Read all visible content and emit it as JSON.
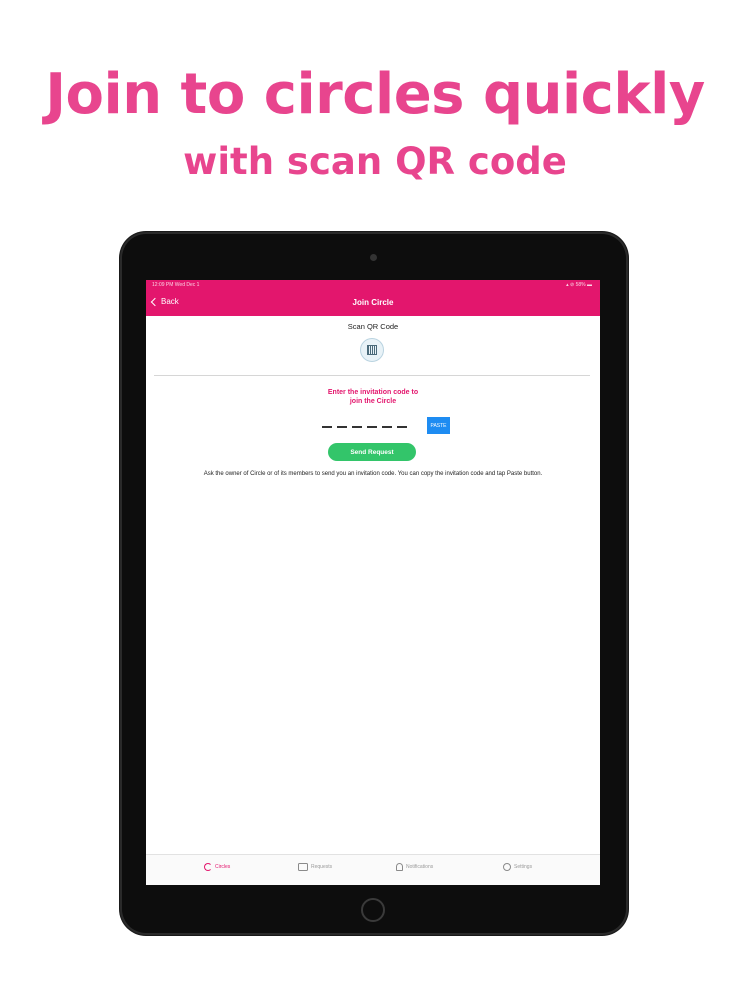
{
  "headline": {
    "line1": "Join to circles quickly",
    "line2": "with scan QR code"
  },
  "status_bar": {
    "time": "12:09 PM   Wed Dec 1",
    "right": "▴ ⊘ 58% ▬"
  },
  "nav": {
    "back_label": "Back",
    "title": "Join Circle"
  },
  "scan": {
    "label": "Scan QR Code",
    "icon": "qr-code-icon"
  },
  "invite": {
    "prompt_line1": "Enter the invitation code to",
    "prompt_line2": "join the Circle",
    "paste_label": "PASTE",
    "send_label": "Send Request",
    "help_text": "Ask the owner of Circle or of its members to send you an invitation code. You can copy the invitation code and tap Paste button."
  },
  "tabs": [
    {
      "label": "Circles",
      "icon": "circles-icon",
      "active": true
    },
    {
      "label": "Requests",
      "icon": "requests-icon",
      "active": false
    },
    {
      "label": "Notifications",
      "icon": "bell-icon",
      "active": false
    },
    {
      "label": "Settings",
      "icon": "user-icon",
      "active": false
    }
  ],
  "colors": {
    "headline": "#e8458e",
    "brand": "#e3166d",
    "paste": "#1e8cf2",
    "send": "#33c56a"
  }
}
